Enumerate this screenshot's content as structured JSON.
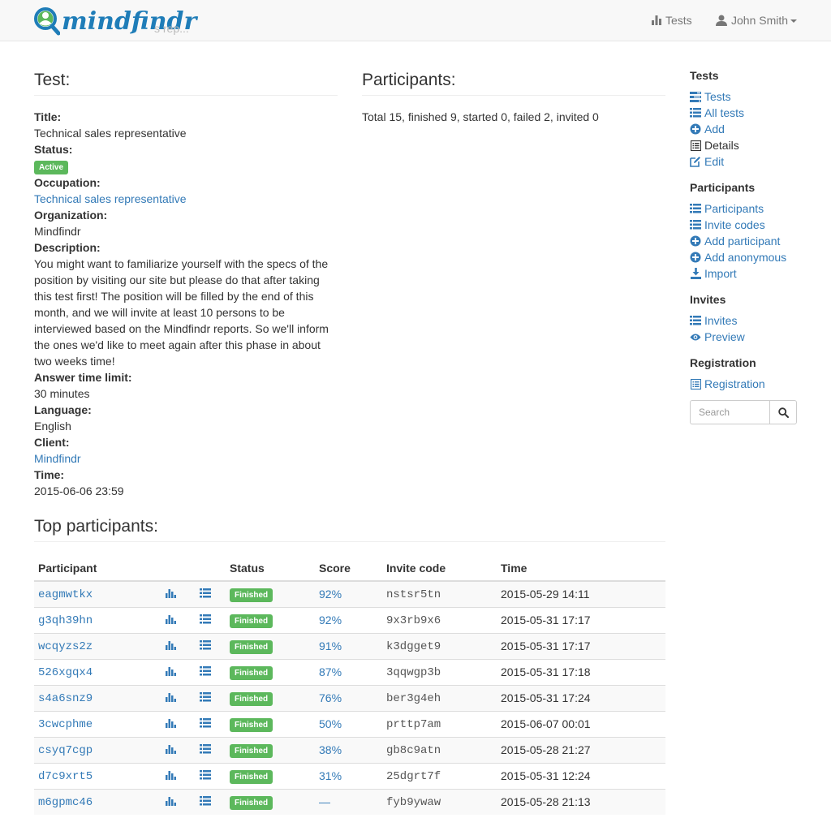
{
  "colors": {
    "accent": "#337ab7",
    "success": "#5cb85c",
    "brand": "#1f7db8"
  },
  "navbar": {
    "brand": "mindfindr",
    "ghost_text": "s rep...",
    "tests_label": "Tests",
    "user_label": "John Smith"
  },
  "test": {
    "heading": "Test:",
    "title_label": "Title:",
    "title_value": "Technical sales representative",
    "status_label": "Status:",
    "status_value": "Active",
    "occupation_label": "Occupation:",
    "occupation_value": "Technical sales representative",
    "organization_label": "Organization:",
    "organization_value": "Mindfindr",
    "description_label": "Description:",
    "description_value": "You might want to familiarize yourself with the specs of the position by visiting our site but please do that after taking this test first! The position will be filled by the end of this month, and we will invite at least 10 persons to be interviewed based on the Mindfindr reports. So we'll inform the ones we'd like to meet again after this phase in about two weeks time!",
    "time_limit_label": "Answer time limit:",
    "time_limit_value": "30 minutes",
    "language_label": "Language:",
    "language_value": "English",
    "client_label": "Client:",
    "client_value": "Mindfindr",
    "time_label": "Time:",
    "time_value": "2015-06-06 23:59"
  },
  "participants": {
    "heading": "Participants:",
    "summary": "Total 15, finished 9, started 0, failed 2, invited 0"
  },
  "sidebar": {
    "tests_heading": "Tests",
    "tests_items": [
      {
        "label": "Tests",
        "icon": "tasks-icon"
      },
      {
        "label": "All tests",
        "icon": "list-icon"
      },
      {
        "label": "Add",
        "icon": "plus-circle-icon"
      },
      {
        "label": "Details",
        "icon": "list-alt-icon"
      },
      {
        "label": "Edit",
        "icon": "edit-icon"
      }
    ],
    "participants_heading": "Participants",
    "participants_items": [
      {
        "label": "Participants",
        "icon": "list-icon"
      },
      {
        "label": "Invite codes",
        "icon": "list-icon"
      },
      {
        "label": "Add participant",
        "icon": "plus-circle-icon"
      },
      {
        "label": "Add anonymous",
        "icon": "plus-circle-icon"
      },
      {
        "label": "Import",
        "icon": "import-icon"
      }
    ],
    "invites_heading": "Invites",
    "invites_items": [
      {
        "label": "Invites",
        "icon": "list-icon"
      },
      {
        "label": "Preview",
        "icon": "eye-icon"
      }
    ],
    "registration_heading": "Registration",
    "registration_items": [
      {
        "label": "Registration",
        "icon": "list-alt-icon"
      }
    ],
    "search_placeholder": "Search"
  },
  "top": {
    "heading": "Top participants:",
    "columns": [
      "Participant",
      "",
      "",
      "Status",
      "Score",
      "Invite code",
      "Time"
    ],
    "rows": [
      {
        "participant": "eagmwtkx",
        "status": "Finished",
        "score": "92%",
        "code": "nstsr5tn",
        "time": "2015-05-29 14:11"
      },
      {
        "participant": "g3qh39hn",
        "status": "Finished",
        "score": "92%",
        "code": "9x3rb9x6",
        "time": "2015-05-31 17:17"
      },
      {
        "participant": "wcqyzs2z",
        "status": "Finished",
        "score": "91%",
        "code": "k3dgget9",
        "time": "2015-05-31 17:17"
      },
      {
        "participant": "526xgqx4",
        "status": "Finished",
        "score": "87%",
        "code": "3qqwgp3b",
        "time": "2015-05-31 17:18"
      },
      {
        "participant": "s4a6snz9",
        "status": "Finished",
        "score": "76%",
        "code": "ber3g4eh",
        "time": "2015-05-31 17:24"
      },
      {
        "participant": "3cwcphme",
        "status": "Finished",
        "score": "50%",
        "code": "prttp7am",
        "time": "2015-06-07 00:01"
      },
      {
        "participant": "csyq7cgp",
        "status": "Finished",
        "score": "38%",
        "code": "gb8c9atn",
        "time": "2015-05-28 21:27"
      },
      {
        "participant": "d7c9xrt5",
        "status": "Finished",
        "score": "31%",
        "code": "25dgrt7f",
        "time": "2015-05-31 12:24"
      },
      {
        "participant": "m6gpmc46",
        "status": "Finished",
        "score": "—",
        "code": "fyb9ywaw",
        "time": "2015-05-28 21:13"
      }
    ]
  }
}
